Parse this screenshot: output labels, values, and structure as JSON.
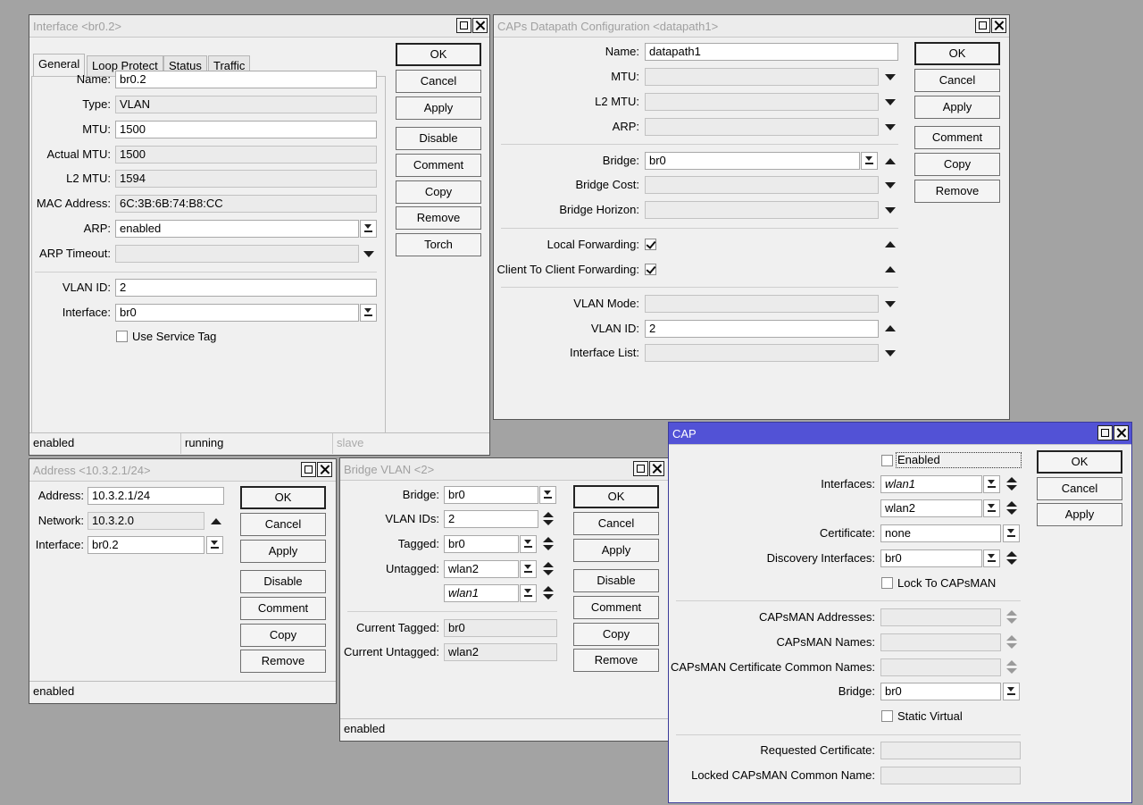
{
  "interface_window": {
    "title": "Interface <br0.2>",
    "tabs": [
      "General",
      "Loop Protect",
      "Status",
      "Traffic"
    ],
    "labels": {
      "name": "Name:",
      "type": "Type:",
      "mtu": "MTU:",
      "actual_mtu": "Actual MTU:",
      "l2_mtu": "L2 MTU:",
      "mac_address": "MAC Address:",
      "arp": "ARP:",
      "arp_timeout": "ARP Timeout:",
      "vlan_id": "VLAN ID:",
      "interface": "Interface:"
    },
    "values": {
      "name": "br0.2",
      "type": "VLAN",
      "mtu": "1500",
      "actual_mtu": "1500",
      "l2_mtu": "1594",
      "mac_address": "6C:3B:6B:74:B8:CC",
      "arp": "enabled",
      "arp_timeout": "",
      "vlan_id": "2",
      "interface": "br0"
    },
    "use_service_tag_label": "Use Service Tag",
    "use_service_tag_checked": false,
    "buttons": [
      "OK",
      "Cancel",
      "Apply",
      "Disable",
      "Comment",
      "Copy",
      "Remove",
      "Torch"
    ],
    "status": [
      "enabled",
      "running",
      "slave"
    ]
  },
  "caps_datapath_window": {
    "title": "CAPs Datapath Configuration <datapath1>",
    "labels": {
      "name": "Name:",
      "mtu": "MTU:",
      "l2_mtu": "L2 MTU:",
      "arp": "ARP:",
      "bridge": "Bridge:",
      "bridge_cost": "Bridge Cost:",
      "bridge_horizon": "Bridge Horizon:",
      "local_forwarding": "Local Forwarding:",
      "client_to_client_forwarding": "Client To Client Forwarding:",
      "vlan_mode": "VLAN Mode:",
      "vlan_id": "VLAN ID:",
      "interface_list": "Interface List:"
    },
    "values": {
      "name": "datapath1",
      "mtu": "",
      "l2_mtu": "",
      "arp": "",
      "bridge": "br0",
      "bridge_cost": "",
      "bridge_horizon": "",
      "local_forwarding": true,
      "client_to_client_forwarding": true,
      "vlan_mode": "",
      "vlan_id": "2",
      "interface_list": ""
    },
    "buttons": [
      "OK",
      "Cancel",
      "Apply",
      "Comment",
      "Copy",
      "Remove"
    ]
  },
  "address_window": {
    "title": "Address <10.3.2.1/24>",
    "labels": {
      "address": "Address:",
      "network": "Network:",
      "interface": "Interface:"
    },
    "values": {
      "address": "10.3.2.1/24",
      "network": "10.3.2.0",
      "interface": "br0.2"
    },
    "buttons": [
      "OK",
      "Cancel",
      "Apply",
      "Disable",
      "Comment",
      "Copy",
      "Remove"
    ],
    "status": "enabled"
  },
  "bridge_vlan_window": {
    "title": "Bridge VLAN <2>",
    "labels": {
      "bridge": "Bridge:",
      "vlan_ids": "VLAN IDs:",
      "tagged": "Tagged:",
      "untagged": "Untagged:",
      "current_tagged": "Current Tagged:",
      "current_untagged": "Current Untagged:"
    },
    "values": {
      "bridge": "br0",
      "vlan_ids": "2",
      "tagged": "br0",
      "untagged_1": "wlan2",
      "untagged_2": "wlan1",
      "current_tagged": "br0",
      "current_untagged": "wlan2"
    },
    "buttons": [
      "OK",
      "Cancel",
      "Apply",
      "Disable",
      "Comment",
      "Copy",
      "Remove"
    ],
    "status": "enabled"
  },
  "cap_window": {
    "title": "CAP",
    "labels": {
      "enabled": "Enabled",
      "interfaces": "Interfaces:",
      "certificate": "Certificate:",
      "discovery_interfaces": "Discovery Interfaces:",
      "lock_to_capsman": "Lock To CAPsMAN",
      "capsman_addresses": "CAPsMAN Addresses:",
      "capsman_names": "CAPsMAN Names:",
      "capsman_cert_common_names": "CAPsMAN Certificate Common Names:",
      "bridge": "Bridge:",
      "static_virtual": "Static Virtual",
      "requested_certificate": "Requested Certificate:",
      "locked_capsman_common_name": "Locked CAPsMAN Common Name:"
    },
    "values": {
      "enabled": false,
      "interface_1": "wlan1",
      "interface_2": "wlan2",
      "certificate": "none",
      "discovery_interfaces": "br0",
      "lock_to_capsman": false,
      "capsman_addresses": "",
      "capsman_names": "",
      "capsman_cert_common_names": "",
      "bridge": "br0",
      "static_virtual": false,
      "requested_certificate": "",
      "locked_capsman_common_name": ""
    },
    "buttons": [
      "OK",
      "Cancel",
      "Apply"
    ],
    "colors": {
      "active_titlebar": "#5252d6"
    }
  }
}
